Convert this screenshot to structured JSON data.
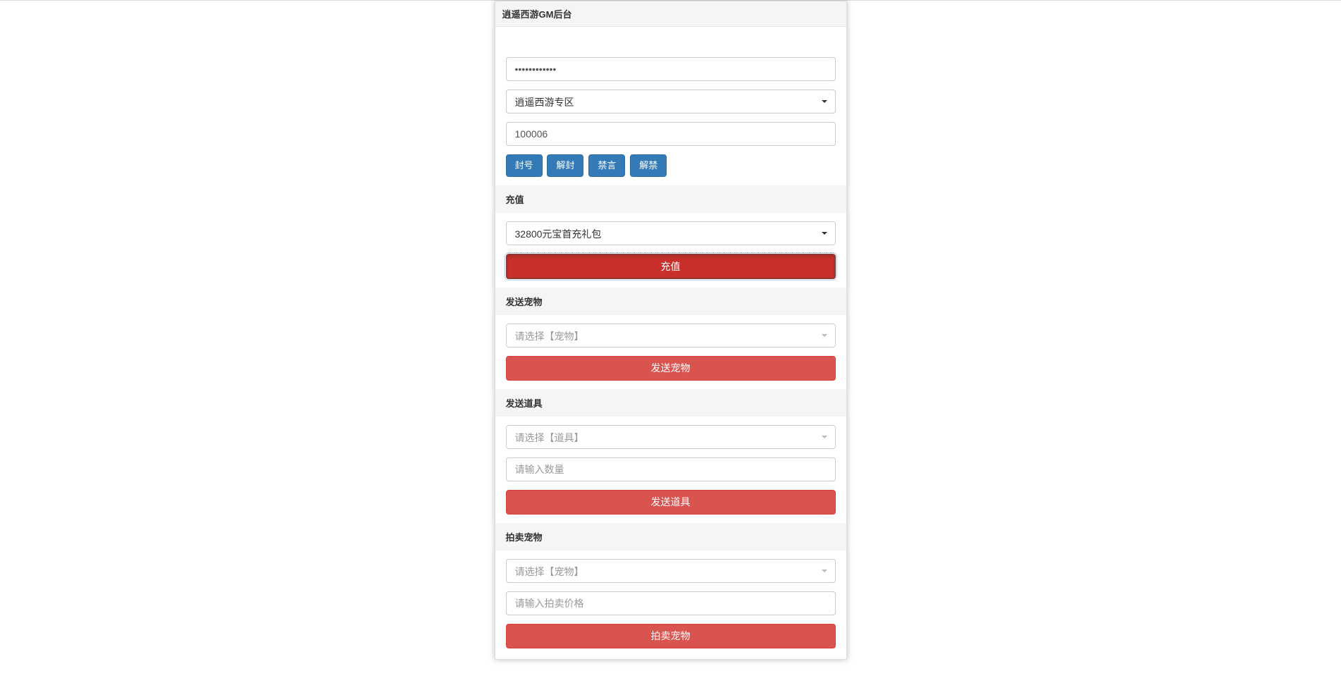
{
  "header": {
    "title": "逍遥西游GM后台"
  },
  "top": {
    "password_value": "••••••••••••",
    "server_selected": "逍遥西游专区",
    "player_id_value": "100006",
    "actions": {
      "ban": "封号",
      "unban": "解封",
      "mute": "禁言",
      "unmute": "解禁"
    }
  },
  "recharge": {
    "title": "充值",
    "package_selected": "32800元宝首充礼包",
    "submit": "充值"
  },
  "send_pet": {
    "title": "发送宠物",
    "select_placeholder": "请选择【宠物】",
    "submit": "发送宠物"
  },
  "send_item": {
    "title": "发送道具",
    "select_placeholder": "请选择【道具】",
    "qty_placeholder": "请输入数量",
    "submit": "发送道具"
  },
  "auction_pet": {
    "title": "拍卖宠物",
    "select_placeholder": "请选择【宠物】",
    "price_placeholder": "请输入拍卖价格",
    "submit": "拍卖宠物"
  }
}
